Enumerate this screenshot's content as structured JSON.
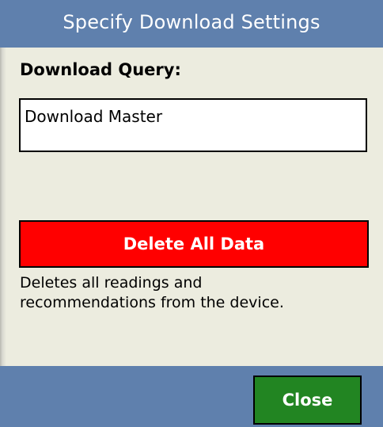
{
  "dialog": {
    "title": "Specify Download Settings"
  },
  "query": {
    "label": "Download Query:",
    "value": "Download Master"
  },
  "delete": {
    "button_label": "Delete All Data",
    "description_lines": [
      "Deletes all readings and",
      "recommendations from the device."
    ]
  },
  "footer": {
    "close_label": "Close"
  },
  "colors": {
    "title_bar": "#5f80ad",
    "background": "#ececdf",
    "delete_button": "#ff0000",
    "close_button": "#228522"
  }
}
